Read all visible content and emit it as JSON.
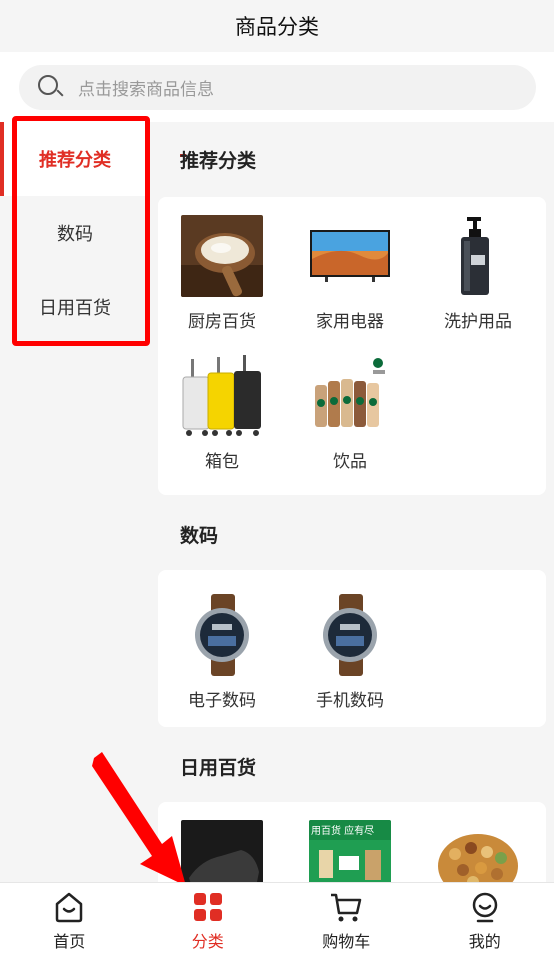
{
  "header": {
    "title": "商品分类"
  },
  "search": {
    "placeholder": "点击搜索商品信息"
  },
  "sidebar": {
    "items": [
      {
        "label": "推荐分类",
        "active": true
      },
      {
        "label": "数码",
        "active": false
      },
      {
        "label": "日用百货",
        "active": false
      }
    ]
  },
  "sections": [
    {
      "title": "推荐分类",
      "items": [
        {
          "label": "厨房百货",
          "image": "rice-bowl"
        },
        {
          "label": "家用电器",
          "image": "television"
        },
        {
          "label": "洗护用品",
          "image": "pump-bottle"
        },
        {
          "label": "箱包",
          "image": "suitcases"
        },
        {
          "label": "饮品",
          "image": "coffee-bottles"
        }
      ]
    },
    {
      "title": "数码",
      "items": [
        {
          "label": "电子数码",
          "image": "smartwatch"
        },
        {
          "label": "手机数码",
          "image": "smartwatch"
        }
      ]
    },
    {
      "title": "日用百货",
      "items": [
        {
          "label": "",
          "image": "sneaker"
        },
        {
          "label": "",
          "image": "store-banner",
          "image_text": "用百货 应有尽"
        },
        {
          "label": "",
          "image": "nuts"
        }
      ]
    }
  ],
  "tabbar": {
    "items": [
      {
        "label": "首页",
        "icon": "home-icon",
        "active": false
      },
      {
        "label": "分类",
        "icon": "category-icon",
        "active": true
      },
      {
        "label": "购物车",
        "icon": "cart-icon",
        "active": false
      },
      {
        "label": "我的",
        "icon": "profile-icon",
        "active": false
      }
    ]
  },
  "colors": {
    "accent": "#e02e24",
    "annotation": "#ff0000",
    "background": "#f5f5f5"
  }
}
